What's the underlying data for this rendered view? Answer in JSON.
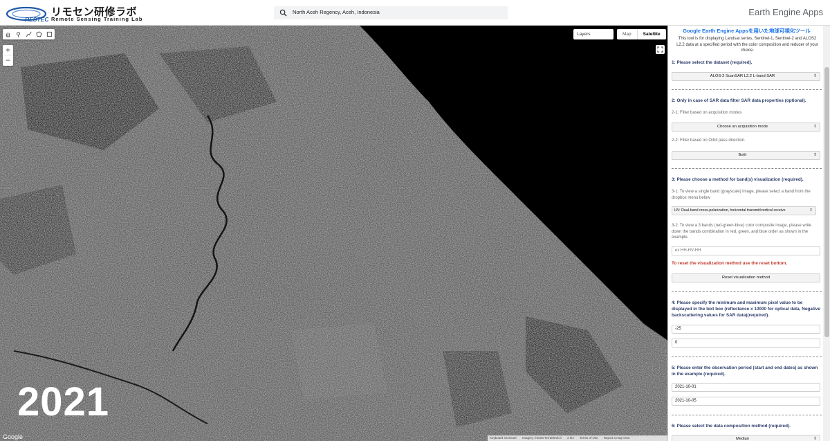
{
  "header": {
    "logo_jp": "リモセン研修ラボ",
    "logo_en": "Remote Sensing Training Lab",
    "logo_mark": "RESTEC",
    "search_value": "North Aceh Regency, Aceh, Indonesia",
    "app_title": "Earth Engine Apps"
  },
  "map": {
    "year_label": "2021",
    "layers_label": "Layers",
    "maptype_map": "Map",
    "maptype_satellite": "Satellite",
    "zoom_in": "+",
    "zoom_out": "−",
    "google_logo": "Google",
    "attribution": [
      "Keyboard shortcuts",
      "Imagery ©2023 TerraMetrics",
      "2 km",
      "Terms of Use",
      "Report a map error"
    ],
    "tool_icons": [
      "hand-icon",
      "point-icon",
      "line-icon",
      "polygon-icon",
      "rectangle-icon"
    ]
  },
  "panel": {
    "title": "Google Earth Engine Appsを用いた地球可視化ツール",
    "intro": "This tool is for displaying Landsat series, Sentinel-1, Sentinel-2 and ALOS2 L2.2 data at a specified period with the color composition and reducer of your choice.",
    "s1_heading": "1: Please select the dataset (required).",
    "s1_value": "ALOS-2 ScanSAR L2.2 L-band SAR",
    "s2_heading": "2: Only in case of SAR data filter SAR data properties (optional).",
    "s2_1": "2-1: Filter based on acquisition modes",
    "s2_1_value": "Choose an acquisition mode",
    "s2_2": "2-2: Filter based on Orbit pass direction.",
    "s2_2_value": "Both",
    "s3_heading": "3: Please choose a method for band(s) visualization (required).",
    "s3_1": "3-1: To view a single band (grayscale) image, please select a band from the dropbox menu below",
    "s3_1_value": "HV: Dual-band cross-polarization, horizontal transmit/vertical receive",
    "s3_2": "3-2: To view a 3 bands (red-green-blue) color composite image, please write down the bands combination in red, green, and blue order as shown in the example.",
    "s3_2_placeholder": "ex:HH-HV-HH",
    "reset_note": "To reset the visualization method use the reset bottom.",
    "reset_button": "Reset visualization method",
    "s4_heading": "4: Please specify the minimum and maximum pixel value to be displayed in the text box (reflectance x 10000 for optical data, Negative backscattering values for SAR data)(required).",
    "s4_min": "-25",
    "s4_max": "0",
    "s5_heading": "5: Please enter the observation period (start and end dates) as shown in the example (required).",
    "s5_start": "2021-10-01",
    "s5_end": "2021-10-05",
    "s6_heading": "6: Please select the data composition method (required).",
    "s6_value": "Median"
  },
  "colors": {
    "accent_blue": "#1a73e8",
    "heading_navy": "#2c3e6b",
    "warning_red": "#c0392b",
    "logo_blue": "#1f5aa6"
  }
}
